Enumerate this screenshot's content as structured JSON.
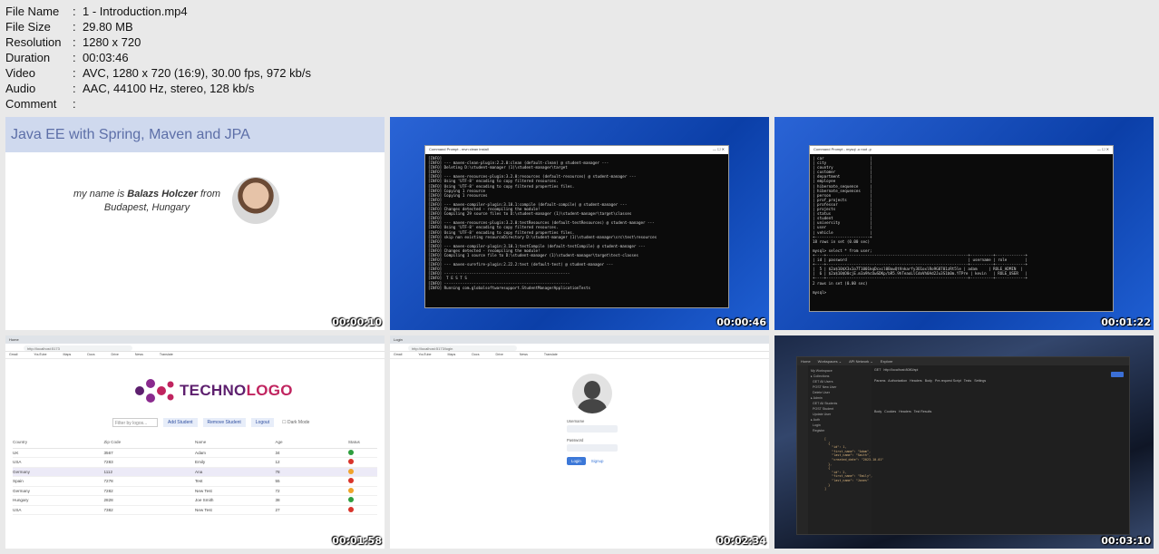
{
  "meta": [
    {
      "key": "File Name",
      "value": "1 - Introduction.mp4"
    },
    {
      "key": "File Size",
      "value": "29.80 MB"
    },
    {
      "key": "Resolution",
      "value": "1280 x 720"
    },
    {
      "key": "Duration",
      "value": "00:03:46"
    },
    {
      "key": "Video",
      "value": "AVC, 1280 x 720 (16:9), 30.00 fps, 972 kb/s"
    },
    {
      "key": "Audio",
      "value": "AAC, 44100 Hz, stereo, 128 kb/s"
    },
    {
      "key": "Comment",
      "value": ""
    }
  ],
  "separator": ":",
  "thumbs": {
    "t1": {
      "time": "00:00:10",
      "title": "Java EE with Spring, Maven and JPA",
      "intro_pre": "my name is ",
      "intro_name": "Balazs Holczer",
      "intro_post": " from",
      "intro_city": "Budapest, Hungary"
    },
    "t2": {
      "time": "00:00:46",
      "window_title": "Command Prompt - mvn clean install"
    },
    "t3": {
      "time": "00:01:22",
      "window_title": "Command Prompt - mysql -u root -p"
    },
    "t4": {
      "time": "00:01:58",
      "tab": "Home",
      "url": "http://localhost:5173",
      "logo_a": "TECHNO",
      "logo_b": "LOGO",
      "filter_placeholder": "Filter by logos...",
      "buttons": [
        "Add Student",
        "Remove Student",
        "Logout"
      ],
      "dark_mode": "Dark Mode",
      "columns": [
        "Country",
        "Zip Code",
        "Name",
        "Age",
        "Status"
      ],
      "rows": [
        {
          "country": "UK",
          "zip": "3567",
          "name": "Adam",
          "age": "34",
          "status": "green"
        },
        {
          "country": "USA",
          "zip": "7283",
          "name": "Emily",
          "age": "12",
          "status": "red"
        },
        {
          "country": "Germany",
          "zip": "1112",
          "name": "Ana",
          "age": "78",
          "status": "orange"
        },
        {
          "country": "Spain",
          "zip": "7278",
          "name": "Test",
          "age": "55",
          "status": "red"
        },
        {
          "country": "Germany",
          "zip": "7282",
          "name": "New Test",
          "age": "72",
          "status": "orange"
        },
        {
          "country": "Hungary",
          "zip": "2828",
          "name": "Joe Smith",
          "age": "38",
          "status": "green"
        },
        {
          "country": "USA",
          "zip": "7382",
          "name": "New Test",
          "age": "27",
          "status": "red"
        }
      ]
    },
    "t5": {
      "time": "00:02:34",
      "tab": "Login",
      "url": "http://localhost:5173/login",
      "username": "Username",
      "password": "Password",
      "login": "Login",
      "signup": "Signup"
    },
    "t6": {
      "time": "00:03:10",
      "workspace": "My Workspace",
      "tab": "Explore",
      "send": "Send"
    }
  },
  "colors": {
    "green": "#2e9e3e",
    "red": "#d9342b",
    "orange": "#f0a42b"
  }
}
